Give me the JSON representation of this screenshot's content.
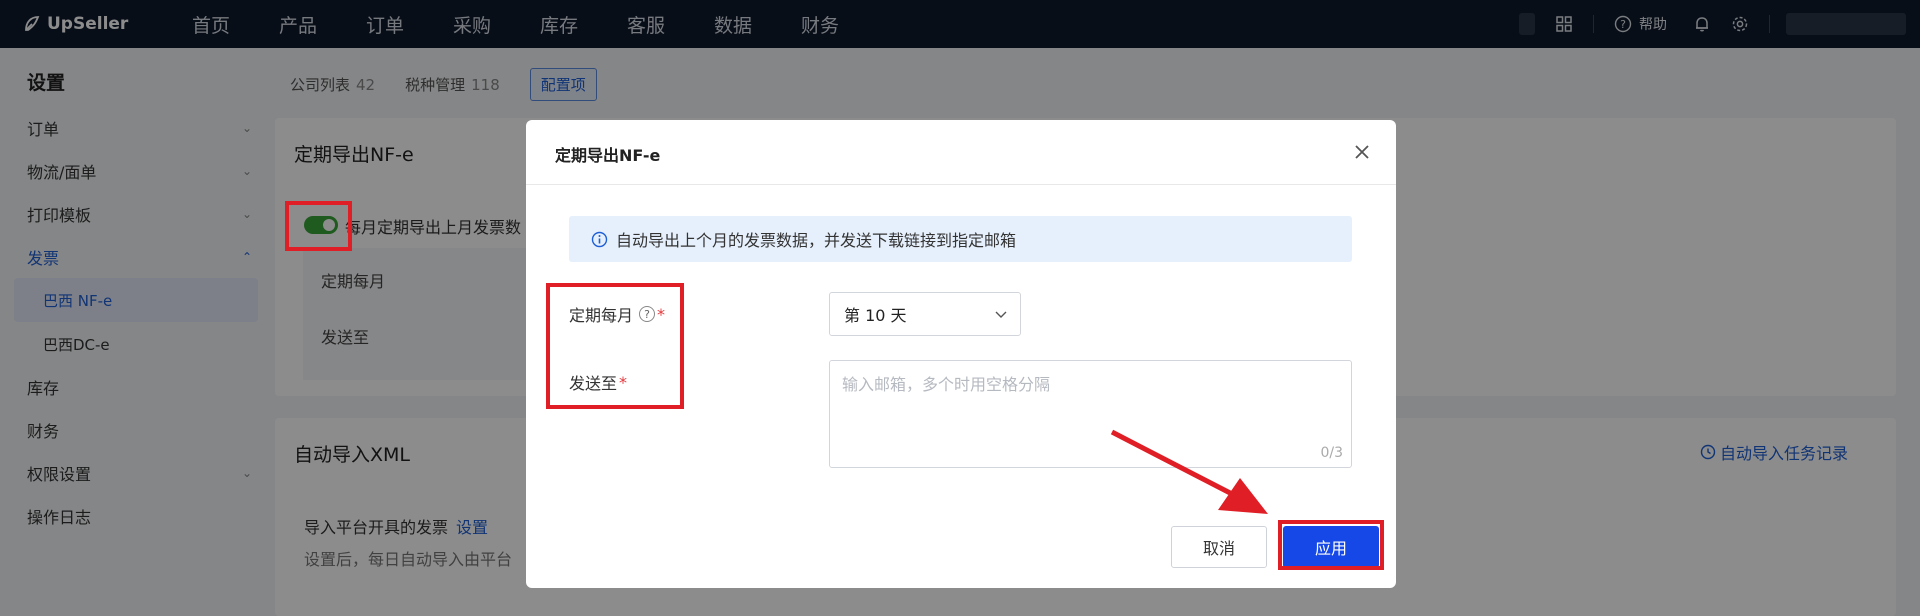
{
  "app": {
    "brand": "UpSeller"
  },
  "topnav": {
    "items": [
      "首页",
      "产品",
      "订单",
      "采购",
      "库存",
      "客服",
      "数据",
      "财务"
    ],
    "help_label": "帮助",
    "icons": {
      "grid": "grid-icon",
      "help": "help-circle-icon",
      "bell": "bell-icon",
      "settings": "gear-icon"
    }
  },
  "sidebar": {
    "title": "设置",
    "items": [
      {
        "label": "订单",
        "chevron": "down"
      },
      {
        "label": "物流/面单",
        "chevron": "down"
      },
      {
        "label": "打印模板",
        "chevron": "down"
      },
      {
        "label": "发票",
        "chevron": "up"
      },
      {
        "label": "库存"
      },
      {
        "label": "财务"
      },
      {
        "label": "权限设置",
        "chevron": "down"
      },
      {
        "label": "操作日志"
      }
    ],
    "sub_items": [
      "巴西 NF-e",
      "巴西DC-e"
    ],
    "selected_sub": "巴西 NF-e"
  },
  "tabs": [
    {
      "label": "公司列表",
      "count": "42"
    },
    {
      "label": "税种管理",
      "count": "118"
    },
    {
      "label": "配置项"
    }
  ],
  "card1": {
    "title": "定期导出NF-e",
    "toggle_label": "每月定期导出上月发票数",
    "toggle_on": true,
    "rows": [
      "定期每月",
      "发送至"
    ]
  },
  "card2": {
    "title": "自动导入XML",
    "link": "自动导入任务记录",
    "row_label": "导入平台开具的发票",
    "row_link": "设置",
    "desc": "设置后，每日自动导入由平台"
  },
  "modal": {
    "title": "定期导出NF-e",
    "info": "自动导出上个月的发票数据，并发送下载链接到指定邮箱",
    "field_month_label": "定期每月",
    "field_month_value": "第 10 天",
    "field_send_label": "发送至",
    "email_placeholder": "输入邮箱，多个时用空格分隔",
    "counter": "0/3",
    "cancel_label": "取消",
    "apply_label": "应用"
  },
  "colors": {
    "accent": "#1548e6",
    "highlight": "#e01e26",
    "toggle": "#3aa53a",
    "topbar": "#0f1a2c"
  }
}
